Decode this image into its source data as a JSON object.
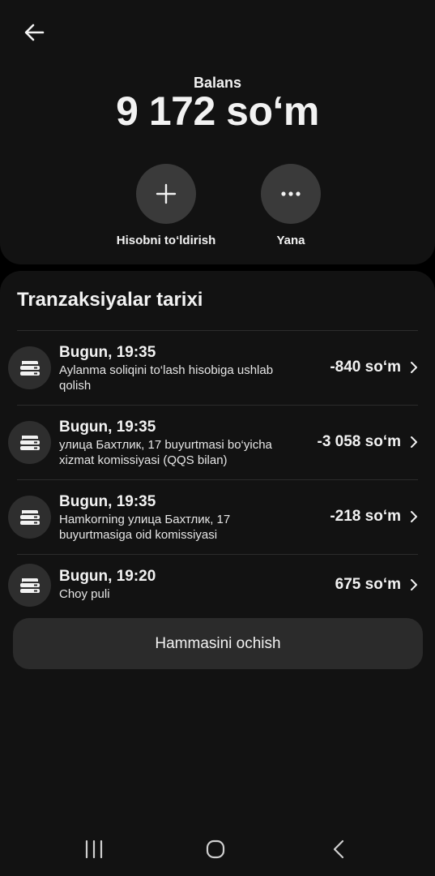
{
  "header": {
    "back_icon": "arrow-left-icon",
    "balance_label": "Balans",
    "balance_amount": "9 172 so‘m"
  },
  "actions": [
    {
      "icon": "plus-icon",
      "label": "Hisobni to‘ldirish"
    },
    {
      "icon": "more-dots-icon",
      "label": "Yana"
    }
  ],
  "transactions": {
    "title": "Tranzaksiyalar tarixi",
    "items": [
      {
        "icon": "wallet-icon",
        "time": "Bugun, 19:35",
        "description_line1": "Aylanma soliqini to‘lash hisobiga ushlab",
        "description_line2": "qolish",
        "amount": "-840 so‘m"
      },
      {
        "icon": "wallet-icon",
        "time": "Bugun, 19:35",
        "description_line1": "улица Бахтлик, 17 buyurtmasi bo‘yicha",
        "description_line2": "xizmat komissiyasi (QQS bilan)",
        "amount": "-3 058 so‘m"
      },
      {
        "icon": "wallet-icon",
        "time": "Bugun, 19:35",
        "description_line1": "Hamkorning улица Бахтлик, 17",
        "description_line2": "buyurtmasiga oid komissiyasi",
        "amount": "-218 so‘m"
      },
      {
        "icon": "wallet-icon",
        "time": "Bugun, 19:20",
        "description_line1": "Choy puli",
        "description_line2": "",
        "amount": "675 so‘m"
      }
    ],
    "open_all_label": "Hammasini ochish"
  },
  "navbar": {
    "recents_icon": "recents-icon",
    "home_icon": "home-icon",
    "back_icon": "nav-back-icon"
  },
  "colors": {
    "background": "#000000",
    "card": "#121212",
    "button": "#2b2b2b",
    "circle": "#3a3a3a",
    "text": "#f2f2f2"
  }
}
